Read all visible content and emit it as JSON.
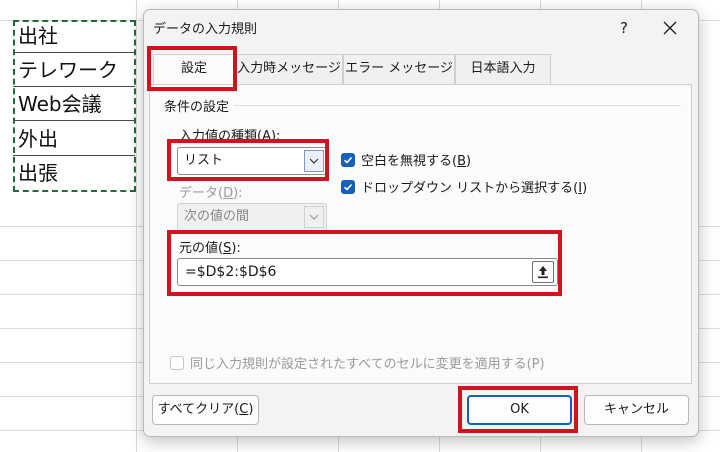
{
  "sheet": {
    "cells": [
      "出社",
      "テレワーク",
      "Web会議",
      "外出",
      "出張"
    ]
  },
  "dialog": {
    "title": "データの入力規則",
    "help_label": "?",
    "close_label": "✕",
    "tabs": [
      {
        "label": "設定",
        "active": true
      },
      {
        "label": "入力時メッセージ",
        "active": false
      },
      {
        "label": "エラー メッセージ",
        "active": false
      },
      {
        "label": "日本語入力",
        "active": false
      }
    ],
    "settings": {
      "group_label": "条件の設定",
      "allow": {
        "label_pre": "入力値の種類(",
        "label_key": "A",
        "label_post": "):",
        "value": "リスト"
      },
      "data": {
        "label_pre": "データ(",
        "label_key": "D",
        "label_post": "):",
        "value": "次の値の間"
      },
      "ignore_blank": {
        "label_pre": "空白を無視する(",
        "label_key": "B",
        "label_post": ")",
        "checked": true
      },
      "in_cell_dropdown": {
        "label_pre": "ドロップダウン リストから選択する(",
        "label_key": "I",
        "label_post": ")",
        "checked": true
      },
      "source": {
        "label_pre": "元の値(",
        "label_key": "S",
        "label_post": "):",
        "value": "=$D$2:$D$6"
      },
      "apply_all": {
        "label": "同じ入力規則が設定されたすべてのセルに変更を適用する(P)",
        "checked": false
      }
    },
    "buttons": {
      "clear_all_pre": "すべてクリア(",
      "clear_all_key": "C",
      "clear_all_post": ")",
      "ok": "OK",
      "cancel": "キャンセル"
    }
  },
  "colors": {
    "highlight": "#d3121f",
    "accent": "#1560bd",
    "selection_border": "#1f6b3a"
  }
}
